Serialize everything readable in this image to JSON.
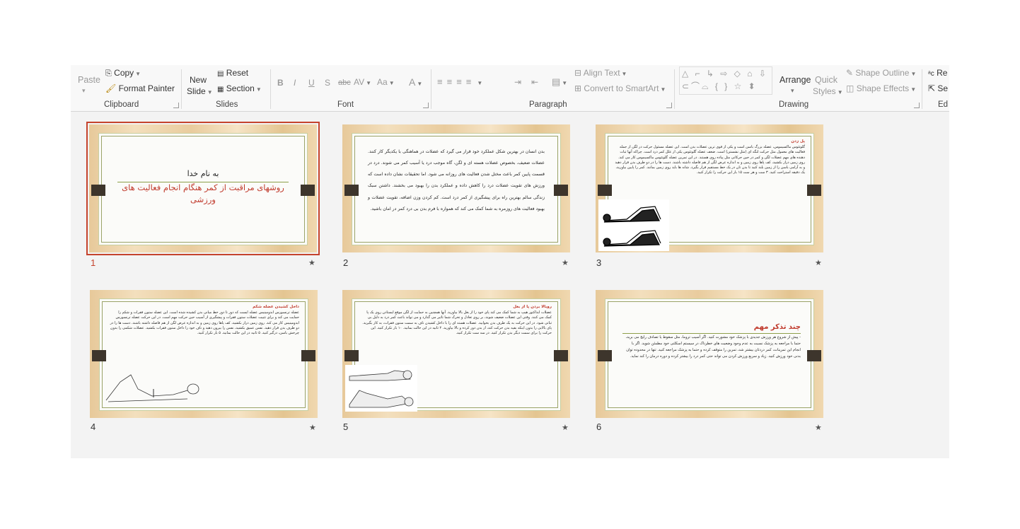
{
  "ribbon": {
    "clipboard": {
      "label": "Clipboard",
      "paste": "Paste",
      "copy": "Copy",
      "format_painter": "Format Painter"
    },
    "slides": {
      "label": "Slides",
      "new_slide_1": "New",
      "new_slide_2": "Slide",
      "reset": "Reset",
      "section": "Section"
    },
    "font": {
      "label": "Font",
      "bold": "B",
      "italic": "I",
      "underline": "U",
      "shadow": "S",
      "strike": "abc",
      "spacing": "AV",
      "case": "Aa",
      "color": "A"
    },
    "paragraph": {
      "label": "Paragraph",
      "align_text": "Align Text",
      "convert_smartart": "Convert to SmartArt"
    },
    "drawing": {
      "label": "Drawing",
      "arrange": "Arrange",
      "quick_styles_1": "Quick",
      "quick_styles_2": "Styles",
      "shape_outline": "Shape Outline",
      "shape_effects": "Shape Effects"
    },
    "editing": {
      "label": "Ed",
      "replace": "Re",
      "select": "Se"
    }
  },
  "slides": [
    {
      "number": "1",
      "selected": true,
      "title_black": "به نام خدا",
      "title_red": "روشهای مراقبت از کمر هنگام انجام فعالیت های ورزشی"
    },
    {
      "number": "2",
      "body": "بدن انسان در بهترین شکل عملکرد خود قرار می گیرد که عضلات در هماهنگی با یکدیگر کار کنند. عضلات ضعیف، بخصوص عضلات هسته ای و لگن، گاه موجب درد یا آسیب کمر می شوند. درد در قسمت پایین کمر باعث مختل شدن فعالیت های روزانه می شود. اما تحقیقات نشان داده است که ورزش های تقویت عضلات درد را کاهش داده و عملکرد بدن را بهبود می بخشند. داشتن سبک زندگی سالم بهترین راه برای پیشگیری از کمر درد است. کم کردن وزن اضافه، تقویت عضلات و بهبود فعالیت های روزمره به شما کمک می کند که همواره با فرم بدن بی درد کمر در امان باشید."
    },
    {
      "number": "3",
      "heading": "پل زدن",
      "body": "گلوتئوس ماکسیموس، عضله بزرگ باسن است و یکی از قوی ترین عضلات بدن است. این عضله مسئول حرکت در لگن از جمله فعالیت های معمول مثل حرکت لنگه ای (مثل نشستن) است. ضعف عضله گلوتئوس یکی از علل کمر درد است. چراکه آنها ثبات دهنده های مهم عضلات لگن و کمر در حین حرکاتی مثل پیاده روی هستند. در این تمرین عضله گلوتئوس ماکسیموس کار می کند. روی زمین دراز بکشید، کف پاها روی زمین و به اندازه عرض لگن از هم فاصله داشته باشند. دست ها را در دو طرف بدن قرار دهید و به آرامی باسن را از زمین بلند کنید تا بدن تان در یک خط مستقیم قرار بگیرد. شانه ها باید روی زمین بمانند. کمر را پایین بیاورید، یک دقیقه استراحت کنید. ۳ ست و هر ست ۱۵ بار این حرکت را تکرار کنید."
    },
    {
      "number": "4",
      "heading": "داخل کشیدن عضله شکم",
      "body": "عضله ترنسورس ابدومینیس عضله ایست که دور تا دور خط میانی بدن کشیده شده است. این عضله ستون فقرات و شکم را حمایت می کند و برای تثبیت عضلات ستون فقرات و پیشگیری از آسیب حین حرکت مهم است. در این حرکت عضله ترنسورس ابدومینیس کار می کند. روی زمین دراز بکشید، کف پاها روی زمین و به اندازه عرض لگن از هم فاصله داشته باشند. دست ها را در دو طرف بدن قرار دهید. نفس عمیق بکشید، نفس را بیرون دهید و ناف خود را داخل ستون فقرات بکشید. عضلات شکمی را بدون چرخش باسن، درگیر کنید. ۵ ثانیه در این حالت بمانید. ۵ بار تکرار کنید."
    },
    {
      "number": "5",
      "heading": "روبالا بردن پا از بغل",
      "body": "عضلات ابداکتور هیپ به شما کمک می کند پای خود را از بغل بالا بیاورید. آنها همچنین به حمایت از لگن موقع ایستادن روی یک پا کمک می کنند. وقتی این عضلات ضعیف شوند، بر روی تعادل و تحرک شما تاثیر می گذارد و می تواند باعث کمر درد به دلیل بی ثباتی شود. در این حرکت به یک طرف بدن بخوابید. عضلات هسته ای را با داخل کشیدن ناف به سمت ستون فقرات، به کار بگیرید. پای بالایی را بدون اینکه بقیه بدن حرکت کند، از بدن دور کرده و بالا بیاورید. ۲ ثانیه در این حالت بمانید. ۱۰ بار تکرار کنید. این حرکت را برای سمت دیگر بدن تکرار کنید. در سه ست تکرار کنید."
    },
    {
      "number": "6",
      "heading": "چند تذکر مهم",
      "body": "- پیش از شروع هر ورزش جدیدی با پزشک خود مشورت کنید. اگر آسیب تروما، مثل سقوط یا تصادف رایج می برید، حتما با مراجعه به پزشک نسبت به عدم وجود وضعیت های خطرناک در سیستم اسکلتی خود مطمئن شوید. اگر با انجام این تمرینات، کمر دردتان بیشتر شد، تمرین را متوقف کرده و حتما به پزشک مراجعه کنید. تنها در محدوده توان بدنی خود ورزش کنید. زیاد و سریع ورزش کردن می تواند حتی کمر درد را بیشتر کرده و دوره درمان را کند نماید."
    }
  ]
}
